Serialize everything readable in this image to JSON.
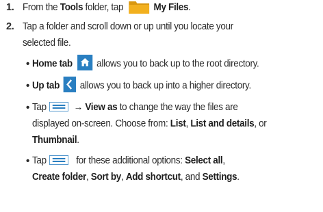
{
  "steps": [
    {
      "number": "1.",
      "text_before": "From the ",
      "bold_tools": "Tools",
      "text_mid": " folder, tap ",
      "icon": "folder-icon",
      "bold_myfiles": "My Files",
      "text_after": "."
    },
    {
      "number": "2.",
      "line1": "Tap a folder and scroll down or up until you locate your",
      "line2": "selected file."
    }
  ],
  "bullets": [
    {
      "bold": "Home tab",
      "icon": "home-icon",
      "text": "allows you to back up to the root directory."
    },
    {
      "bold": "Up tab",
      "icon": "back-chevron-icon",
      "text": "allows you to back up into a higher directory."
    },
    {
      "tap": "Tap",
      "icon": "menu-icon",
      "arrow": "→",
      "bold_viewas": "View as",
      "line1_rest": " to change the way the files are",
      "line2_before": "displayed on-screen. Choose from: ",
      "bold_list": "List",
      "comma1": ", ",
      "bold_listdetails": "List and details",
      "comma_or": ", or",
      "bold_thumbnail": "Thumbnail",
      "period": "."
    },
    {
      "tap": "Tap",
      "icon": "menu-icon",
      "line1_rest": " for these additional options: ",
      "bold_selectall": "Select all",
      "comma1": ",",
      "bold_createfolder": "Create folder",
      "comma2": ", ",
      "bold_sortby": "Sort by",
      "comma3": ", ",
      "bold_addshortcut": "Add shortcut",
      "and": ", and ",
      "bold_settings": "Settings",
      "period": "."
    }
  ],
  "colors": {
    "folder": "#f2b01e",
    "home_tab": "#2a7fc1",
    "up_tab": "#2a7fc1",
    "menu_icon": "#2a7fc1",
    "text": "#2a2a2a"
  }
}
